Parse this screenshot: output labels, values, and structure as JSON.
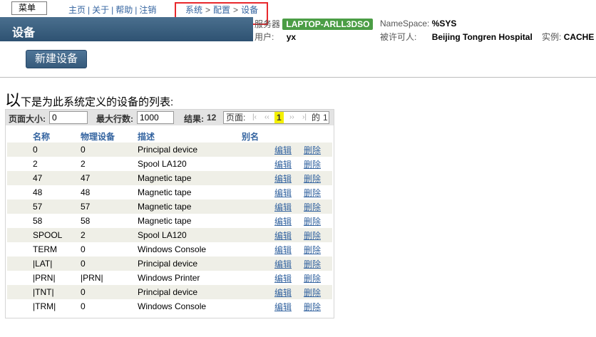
{
  "header": {
    "menu_label": "菜单",
    "nav": [
      "主页",
      "关于",
      "帮助",
      "注销"
    ],
    "nav_sep": "|",
    "breadcrumb": [
      "系统",
      "配置",
      "设备"
    ],
    "breadcrumb_sep": ">",
    "page_title": "设备",
    "server_label": "服务器",
    "server_value": "LAPTOP-ARLL3DSO",
    "namespace_label": "NameSpace:",
    "namespace_value": "%SYS",
    "user_label": "用户:",
    "user_value": "yx",
    "licensee_label": "被许可人:",
    "licensee_value": "Beijing Tongren Hospital",
    "instance_label": "实例:",
    "instance_value": "CACHE",
    "highlight_color": "#e8282c",
    "server_badge_color": "#4b9d45"
  },
  "actions": {
    "new_device": "新建设备"
  },
  "description": {
    "first_char": "以",
    "rest": "下是为此系统定义的设备的列表:"
  },
  "pager": {
    "page_size_label": "页面大小:",
    "page_size_value": "0",
    "max_rows_label": "最大行数:",
    "max_rows_value": "1000",
    "results_label": "结果:",
    "results_value": "12",
    "page_label": "页面:",
    "first": "|‹",
    "prev": "‹‹",
    "current": "1",
    "next": "››",
    "last": "›|",
    "of_label": "的",
    "total_pages": "1"
  },
  "table": {
    "columns": [
      "名称",
      "物理设备",
      "描述",
      "别名"
    ],
    "edit_label": "编辑",
    "delete_label": "删除",
    "rows": [
      {
        "name": "0",
        "physical": "0",
        "desc": "Principal device",
        "alias": ""
      },
      {
        "name": "2",
        "physical": "2",
        "desc": "Spool LA120",
        "alias": ""
      },
      {
        "name": "47",
        "physical": "47",
        "desc": "Magnetic tape",
        "alias": ""
      },
      {
        "name": "48",
        "physical": "48",
        "desc": "Magnetic tape",
        "alias": ""
      },
      {
        "name": "57",
        "physical": "57",
        "desc": "Magnetic tape",
        "alias": ""
      },
      {
        "name": "58",
        "physical": "58",
        "desc": "Magnetic tape",
        "alias": ""
      },
      {
        "name": "SPOOL",
        "physical": "2",
        "desc": "Spool LA120",
        "alias": ""
      },
      {
        "name": "TERM",
        "physical": "0",
        "desc": "Windows Console",
        "alias": ""
      },
      {
        "name": "|LAT|",
        "physical": "0",
        "desc": "Principal device",
        "alias": ""
      },
      {
        "name": "|PRN|",
        "physical": "|PRN|",
        "desc": "Windows Printer",
        "alias": ""
      },
      {
        "name": "|TNT|",
        "physical": "0",
        "desc": "Principal device",
        "alias": ""
      },
      {
        "name": "|TRM|",
        "physical": "0",
        "desc": "Windows Console",
        "alias": ""
      }
    ]
  }
}
